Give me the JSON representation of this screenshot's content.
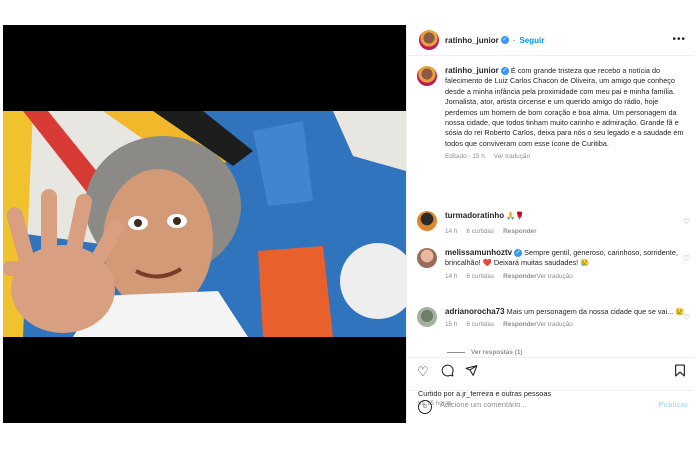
{
  "post": {
    "username": "ratinho_junior",
    "follow_label": "Seguir",
    "caption": "É com grande tristeza que recebo a notícia do falecimento de Luiz Carlos Chacon de Oliveira, um amigo que conheço desde a minha infância pela proximidade com meu pai e minha família. Jornalista, ator, artista circense e um querido amigo do rádio, hoje perdemos um homem de bom coração e boa alma. Um personagem da nossa cidade, que todos tinham muito carinho e admiração. Grande fã e sósia do rei Roberto Carlos, deixa para nós o seu legado e a saudade em todos que conviveram com esse ícone de Curitiba.",
    "caption_meta_edited": "Editado · 15 h",
    "caption_meta_translate": "Ver tradução"
  },
  "comments": [
    {
      "username": "turmadoratinho",
      "text": "🙏🌹",
      "time": "14 h",
      "likes": "6 curtidas",
      "reply": "Responder",
      "translate": ""
    },
    {
      "username": "melissamunhoztv",
      "text": "Sempre gentil, generoso, carinhoso, sorridente, brincalhão! ❤️ Deixará muitas saudades! 😢",
      "time": "14 h",
      "likes": "6 curtidas",
      "reply": "Responder",
      "translate": "Ver tradução"
    },
    {
      "username": "adrianorocha73",
      "text": "Mais um personagem da nossa cidade que se vai... 😢",
      "time": "15 h",
      "likes": "6 curtidas",
      "reply": "Responder",
      "translate": "Ver tradução"
    }
  ],
  "replies_label": "Ver respostas (1)",
  "footer": {
    "liked_by": "Curtido por a.jr_ferreira e outras pessoas",
    "time_ago": "há 15 horas",
    "comment_placeholder": "Adicione um comentário...",
    "publish_label": "Publicar"
  },
  "icons": [
    "verified-icon",
    "more-icon",
    "heart-icon",
    "comment-icon",
    "share-icon",
    "bookmark-icon",
    "emoji-icon"
  ]
}
